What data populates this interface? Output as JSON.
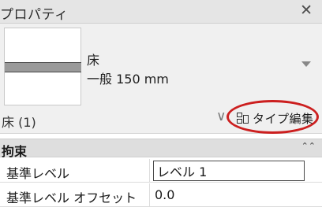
{
  "titlebar": {
    "title": "プロパティ",
    "close_glyph": "✕"
  },
  "type_selector": {
    "name": "床",
    "subtype": "一般 150 mm",
    "dropdown_icon": "triangle-down-icon"
  },
  "instance_filter": {
    "label": "床 (1)",
    "chevron": "∨"
  },
  "edit_type": {
    "label": "タイプ編集",
    "icon": "edit-type-icon"
  },
  "highlight_color": "#cc1f1f",
  "group": {
    "label": "拘束",
    "collapse_glyph": "⌃⌃"
  },
  "properties": [
    {
      "name": "基準レベル",
      "value": "レベル 1",
      "editable": true
    },
    {
      "name": "基準レベル オフセット",
      "value": "0.0",
      "editable": false
    }
  ]
}
